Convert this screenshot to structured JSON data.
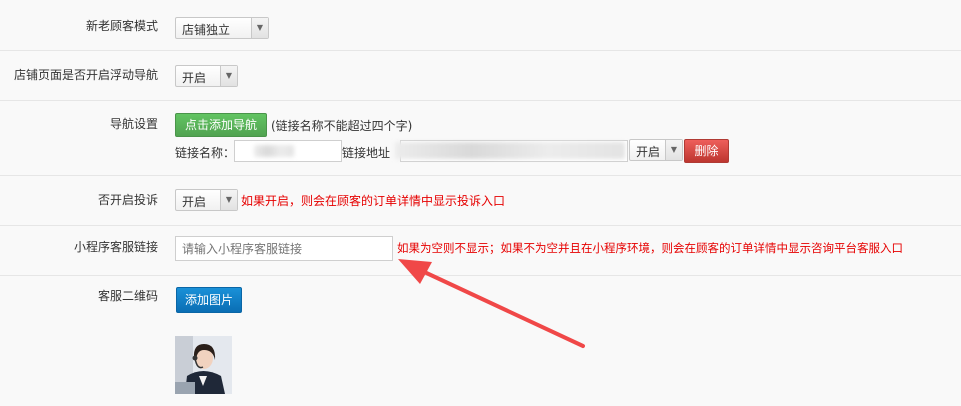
{
  "rows": {
    "customer_mode": {
      "label": "新老顾客模式",
      "value": "店铺独立"
    },
    "floating_nav": {
      "label": "店铺页面是否开启浮动导航",
      "value": "开启"
    },
    "nav_settings": {
      "label": "导航设置",
      "add_button": "点击添加导航",
      "add_hint": "(链接名称不能超过四个字)",
      "link_name_label": "链接名称：",
      "link_addr_label": "链接地址",
      "toggle_value": "开启",
      "delete_button": "删除"
    },
    "complaint": {
      "label": "否开启投诉",
      "value": "开启",
      "hint": "如果开启，则会在顾客的订单详情中显示投诉入口"
    },
    "mini_service_link": {
      "label": "小程序客服链接",
      "placeholder": "请输入小程序客服链接",
      "hint": "如果为空则不显示；如果不为空并且在小程序环境，则会在顾客的订单详情中显示咨询平台客服入口"
    },
    "service_qr": {
      "label": "客服二维码",
      "add_button": "添加图片"
    }
  },
  "colors": {
    "hint_red": "#e60000",
    "arrow_red": "#f04848",
    "green": "#51a351",
    "red": "#bd362f",
    "blue": "#0a6eb4"
  }
}
